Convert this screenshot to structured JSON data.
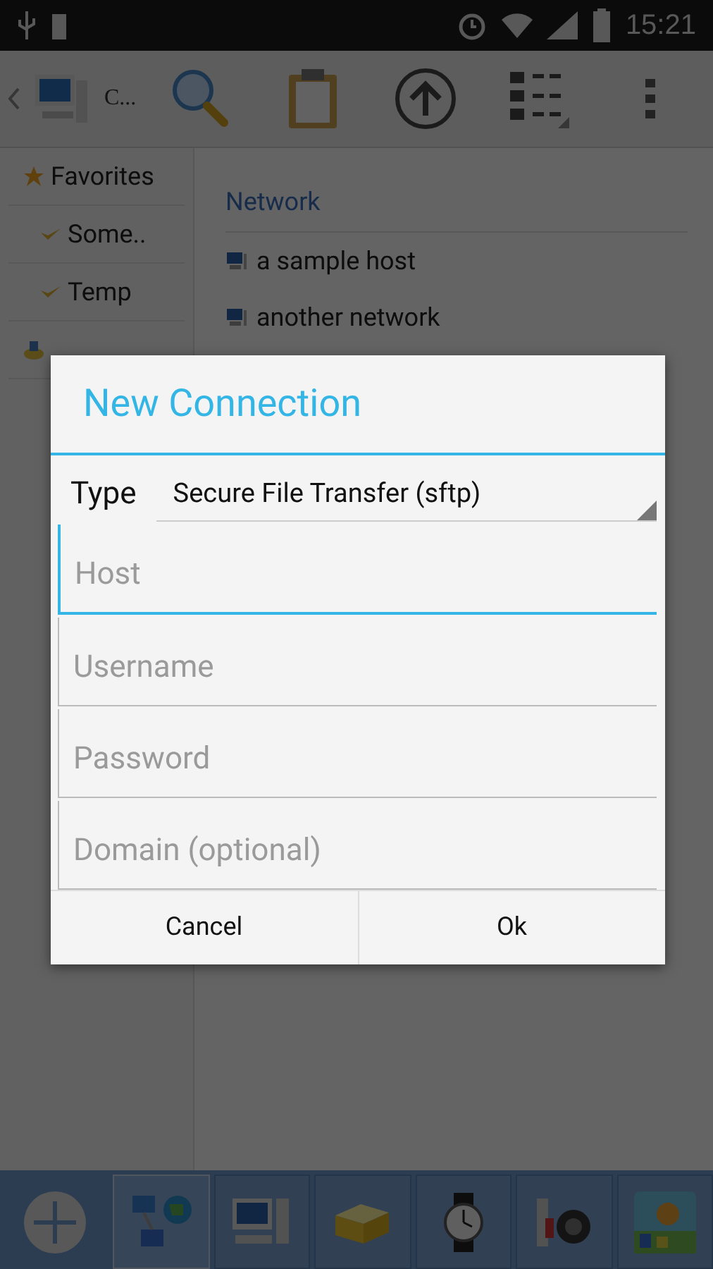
{
  "status_bar": {
    "time": "15:21"
  },
  "toolbar": {
    "location": "C..."
  },
  "sidebar": {
    "items": [
      {
        "label": "Favorites",
        "kind": "header"
      },
      {
        "label": "Some..",
        "kind": "favorite"
      },
      {
        "label": "Temp",
        "kind": "favorite"
      }
    ]
  },
  "content": {
    "heading": "Network",
    "items": [
      "a sample host",
      "another network"
    ]
  },
  "dialog": {
    "title": "New Connection",
    "type_label": "Type",
    "type_value": "Secure File Transfer (sftp)",
    "fields": [
      {
        "placeholder": "Host",
        "focused": true
      },
      {
        "placeholder": "Username",
        "focused": false
      },
      {
        "placeholder": "Password",
        "focused": false
      },
      {
        "placeholder": "Domain (optional)",
        "focused": false
      }
    ],
    "buttons": [
      "Cancel",
      "Ok"
    ]
  },
  "bottom_bar": {
    "tabs": [
      {
        "kind": "network",
        "selected": true
      },
      {
        "kind": "computer",
        "selected": false
      },
      {
        "kind": "box",
        "selected": false
      },
      {
        "kind": "watch",
        "selected": false
      },
      {
        "kind": "camera",
        "selected": false
      },
      {
        "kind": "picture",
        "selected": false
      }
    ]
  }
}
